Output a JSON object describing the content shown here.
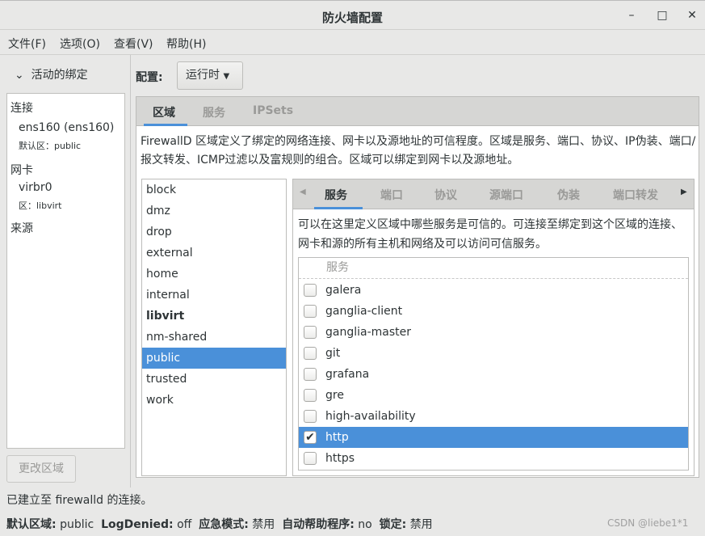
{
  "window": {
    "title": "防火墙配置",
    "controls": [
      "–",
      "□",
      "✕"
    ]
  },
  "menu": [
    "文件(F)",
    "选项(O)",
    "查看(V)",
    "帮助(H)"
  ],
  "sidebar": {
    "header": "活动的绑定",
    "connections_label": "连接",
    "connection": "ens160 (ens160)",
    "connection_zone": "默认区：public",
    "nic_label": "网卡",
    "nic": "virbr0",
    "nic_zone": "区：libvirt",
    "sources_label": "来源",
    "change_zone_button": "更改区域"
  },
  "config": {
    "label": "配置:",
    "value": "运行时"
  },
  "tabs": [
    "区域",
    "服务",
    "IPSets"
  ],
  "active_tab": 0,
  "zone_description": "FirewallD 区域定义了绑定的网络连接、网卡以及源地址的可信程度。区域是服务、端口、协议、IP伪装、端口/报文转发、ICMP过滤以及富规则的组合。区域可以绑定到网卡以及源地址。",
  "zones": [
    "block",
    "dmz",
    "drop",
    "external",
    "home",
    "internal",
    "libvirt",
    "nm-shared",
    "public",
    "trusted",
    "work"
  ],
  "bold_zone": "libvirt",
  "selected_zone": "public",
  "inner_tabs": [
    "服务",
    "端口",
    "协议",
    "源端口",
    "伪装",
    "端口转发"
  ],
  "services_description": "可以在这里定义区域中哪些服务是可信的。可连接至绑定到这个区域的连接、网卡和源的所有主机和网络及可以访问可信服务。",
  "services_header": "服务",
  "services": [
    {
      "name": "galera",
      "checked": false
    },
    {
      "name": "ganglia-client",
      "checked": false
    },
    {
      "name": "ganglia-master",
      "checked": false
    },
    {
      "name": "git",
      "checked": false
    },
    {
      "name": "grafana",
      "checked": false
    },
    {
      "name": "gre",
      "checked": false
    },
    {
      "name": "high-availability",
      "checked": false
    },
    {
      "name": "http",
      "checked": true
    },
    {
      "name": "https",
      "checked": false
    }
  ],
  "selected_service": "http",
  "status": "已建立至 firewalld 的连接。",
  "bottom": {
    "default_zone_label": "默认区域:",
    "default_zone": "public",
    "logdenied_label": "LogDenied:",
    "logdenied": "off",
    "panic_label": "应急模式:",
    "panic": "禁用",
    "helper_label": "自动帮助程序:",
    "helper": "no",
    "lockdown_label": "锁定:",
    "lockdown": "禁用"
  },
  "watermark": "CSDN @liebe1*1",
  "colors": {
    "accent": "#4a90d9"
  }
}
